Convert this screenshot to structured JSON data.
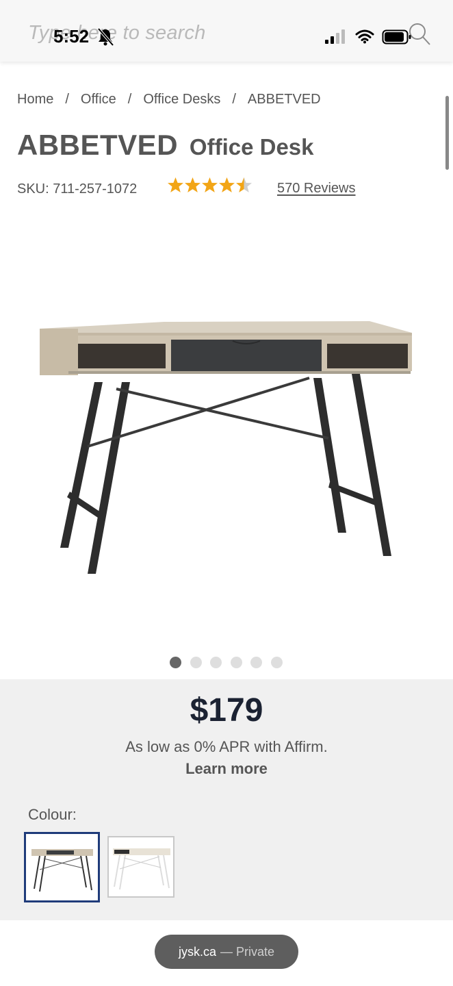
{
  "status_bar": {
    "time": "5:52"
  },
  "search": {
    "placeholder": "Type here to search"
  },
  "breadcrumb": {
    "items": [
      "Home",
      "Office",
      "Office Desks",
      "ABBETVED"
    ],
    "separator": "/"
  },
  "product": {
    "brand": "ABBETVED",
    "name": "Office Desk",
    "sku": "SKU: 711-257-1072",
    "rating": 4.5,
    "reviews_label": "570 Reviews",
    "image_count": 6,
    "active_image": 1
  },
  "pricing": {
    "price": "$179",
    "affirm_text": "As low as 0% APR with Affirm.",
    "learn_more": "Learn more"
  },
  "colour": {
    "label": "Colour:",
    "options": [
      "black-oak",
      "white-oak"
    ],
    "selected": "black-oak"
  },
  "browser": {
    "domain": "jysk.ca",
    "mode": "— Private"
  },
  "colors": {
    "star": "#f2a516",
    "price": "#1b2232",
    "selected_border": "#1f3b7a",
    "panel_bg": "#f0f0f0"
  }
}
